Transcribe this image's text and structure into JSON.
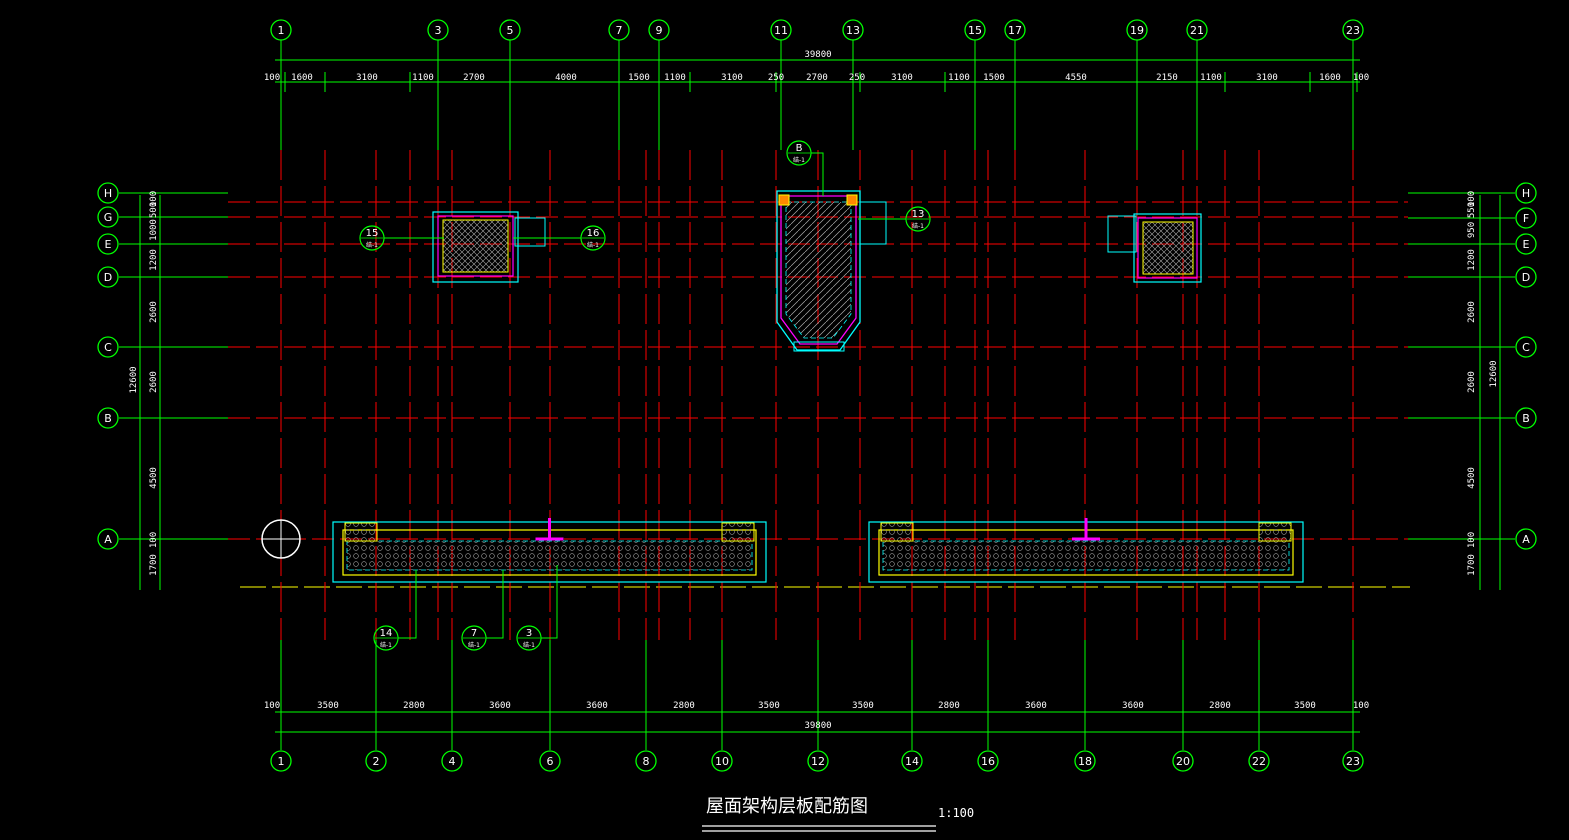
{
  "drawing": {
    "title": "屋面架构层板配筋图",
    "scale": "1:100"
  },
  "top_axes": [
    "1",
    "3",
    "5",
    "7",
    "9",
    "11",
    "13",
    "15",
    "17",
    "19",
    "21",
    "23"
  ],
  "bottom_axes": [
    "1",
    "2",
    "4",
    "6",
    "8",
    "10",
    "12",
    "14",
    "16",
    "18",
    "20",
    "22",
    "23"
  ],
  "left_axes": [
    "H",
    "G",
    "E",
    "D",
    "C",
    "B",
    "A"
  ],
  "right_axes": [
    "H",
    "F",
    "E",
    "D",
    "C",
    "B",
    "A"
  ],
  "top_dims": {
    "total": "39800",
    "segments": [
      "100",
      "1600",
      "3100",
      "1100",
      "2700",
      "4000",
      "1500",
      "1100",
      "3100",
      "250",
      "2700",
      "250",
      "3100",
      "1100",
      "1500",
      "4550",
      "2150",
      "1100",
      "3100",
      "1600",
      "100"
    ]
  },
  "bottom_dims": {
    "total": "39800",
    "segments": [
      "100",
      "3500",
      "2800",
      "3600",
      "3600",
      "2800",
      "3500",
      "3500",
      "2800",
      "3600",
      "3600",
      "2800",
      "3500",
      "100"
    ]
  },
  "left_dims": {
    "total": "12600",
    "segments": [
      "100",
      "500",
      "1000",
      "1200",
      "2600",
      "2600",
      "4500",
      "100",
      "1700"
    ]
  },
  "right_dims": {
    "total": "12600",
    "segments": [
      "100",
      "550",
      "950",
      "1200",
      "2600",
      "2600",
      "4500",
      "100",
      "1700"
    ]
  },
  "detail_callouts": [
    {
      "num": "15",
      "sheet": "结-1"
    },
    {
      "num": "16",
      "sheet": "结-1"
    },
    {
      "num": "B",
      "sheet": "结-1"
    },
    {
      "num": "13",
      "sheet": "结-1"
    },
    {
      "num": "14",
      "sheet": "结-1"
    },
    {
      "num": "7",
      "sheet": "结-1"
    },
    {
      "num": "3",
      "sheet": "结-1"
    }
  ],
  "colors": {
    "axis_green": "#00ff00",
    "beam_red": "#ff0000",
    "slab_cyan": "#00ffff",
    "magenta": "#ff00ff",
    "yellow": "#ffff00",
    "white": "#ffffff"
  }
}
